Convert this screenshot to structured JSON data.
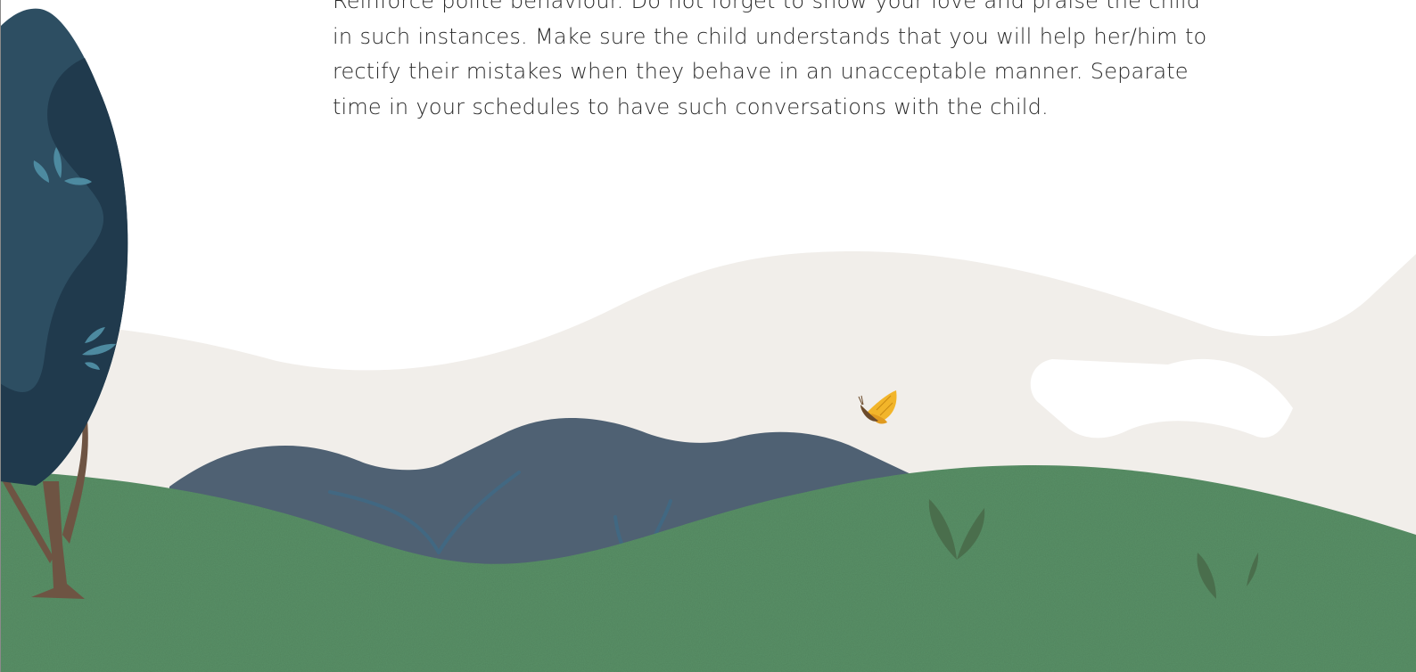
{
  "article": {
    "lines": [
      "Reinforce polite behaviour. Do not forget to show your love and praise the child",
      "in such instances. Make sure the child understands that you will help her/him to",
      "rectify their mistakes when they behave in an unacceptable manner. Separate",
      "time in your schedules to have such conversations with the child."
    ]
  },
  "colors": {
    "text": "#2a2a2a",
    "sky_hill": "#f1eeea",
    "cloud": "#ffffff",
    "mountain": "#4f6173",
    "grass": "#5a9168",
    "grass_dark": "#4a6e4c",
    "tree_light": "#2d4e62",
    "tree_dark": "#203a4d",
    "trunk": "#6e5443",
    "butterfly": "#f2b52a"
  },
  "icons": {
    "butterfly": "butterfly-icon",
    "tree": "tree-icon"
  }
}
